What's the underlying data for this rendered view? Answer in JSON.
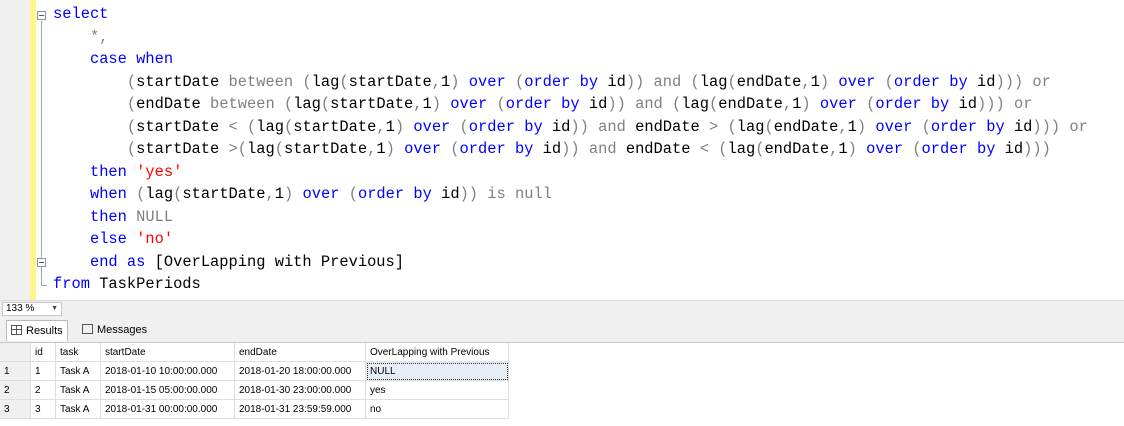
{
  "editor": {
    "lines": [
      [
        {
          "t": "select",
          "c": "kw"
        }
      ],
      [
        {
          "t": "    *,",
          "c": "gr"
        }
      ],
      [
        {
          "t": "    "
        },
        {
          "t": "case when",
          "c": "kw"
        }
      ],
      [
        {
          "t": "        "
        },
        {
          "t": "(",
          "c": "gr"
        },
        {
          "t": "startDate "
        },
        {
          "t": "between",
          "c": "gr"
        },
        {
          "t": " "
        },
        {
          "t": "(",
          "c": "gr"
        },
        {
          "t": "lag"
        },
        {
          "t": "(",
          "c": "gr"
        },
        {
          "t": "startDate"
        },
        {
          "t": ",",
          "c": "gr"
        },
        {
          "t": "1"
        },
        {
          "t": ")",
          "c": "gr"
        },
        {
          "t": " "
        },
        {
          "t": "over",
          "c": "kw"
        },
        {
          "t": " "
        },
        {
          "t": "(",
          "c": "gr"
        },
        {
          "t": "order by",
          "c": "kw"
        },
        {
          "t": " id"
        },
        {
          "t": "))",
          "c": "gr"
        },
        {
          "t": " "
        },
        {
          "t": "and",
          "c": "gr"
        },
        {
          "t": " "
        },
        {
          "t": "(",
          "c": "gr"
        },
        {
          "t": "lag"
        },
        {
          "t": "(",
          "c": "gr"
        },
        {
          "t": "endDate"
        },
        {
          "t": ",",
          "c": "gr"
        },
        {
          "t": "1"
        },
        {
          "t": ")",
          "c": "gr"
        },
        {
          "t": " "
        },
        {
          "t": "over",
          "c": "kw"
        },
        {
          "t": " "
        },
        {
          "t": "(",
          "c": "gr"
        },
        {
          "t": "order by",
          "c": "kw"
        },
        {
          "t": " id"
        },
        {
          "t": ")))",
          "c": "gr"
        },
        {
          "t": " "
        },
        {
          "t": "or",
          "c": "gr"
        }
      ],
      [
        {
          "t": "        "
        },
        {
          "t": "(",
          "c": "gr"
        },
        {
          "t": "endDate "
        },
        {
          "t": "between",
          "c": "gr"
        },
        {
          "t": " "
        },
        {
          "t": "(",
          "c": "gr"
        },
        {
          "t": "lag"
        },
        {
          "t": "(",
          "c": "gr"
        },
        {
          "t": "startDate"
        },
        {
          "t": ",",
          "c": "gr"
        },
        {
          "t": "1"
        },
        {
          "t": ")",
          "c": "gr"
        },
        {
          "t": " "
        },
        {
          "t": "over",
          "c": "kw"
        },
        {
          "t": " "
        },
        {
          "t": "(",
          "c": "gr"
        },
        {
          "t": "order by",
          "c": "kw"
        },
        {
          "t": " id"
        },
        {
          "t": "))",
          "c": "gr"
        },
        {
          "t": " "
        },
        {
          "t": "and",
          "c": "gr"
        },
        {
          "t": " "
        },
        {
          "t": "(",
          "c": "gr"
        },
        {
          "t": "lag"
        },
        {
          "t": "(",
          "c": "gr"
        },
        {
          "t": "endDate"
        },
        {
          "t": ",",
          "c": "gr"
        },
        {
          "t": "1"
        },
        {
          "t": ")",
          "c": "gr"
        },
        {
          "t": " "
        },
        {
          "t": "over",
          "c": "kw"
        },
        {
          "t": " "
        },
        {
          "t": "(",
          "c": "gr"
        },
        {
          "t": "order by",
          "c": "kw"
        },
        {
          "t": " id"
        },
        {
          "t": ")))",
          "c": "gr"
        },
        {
          "t": " "
        },
        {
          "t": "or",
          "c": "gr"
        }
      ],
      [
        {
          "t": "        "
        },
        {
          "t": "(",
          "c": "gr"
        },
        {
          "t": "startDate "
        },
        {
          "t": "<",
          "c": "gr"
        },
        {
          "t": " "
        },
        {
          "t": "(",
          "c": "gr"
        },
        {
          "t": "lag"
        },
        {
          "t": "(",
          "c": "gr"
        },
        {
          "t": "startDate"
        },
        {
          "t": ",",
          "c": "gr"
        },
        {
          "t": "1"
        },
        {
          "t": ")",
          "c": "gr"
        },
        {
          "t": " "
        },
        {
          "t": "over",
          "c": "kw"
        },
        {
          "t": " "
        },
        {
          "t": "(",
          "c": "gr"
        },
        {
          "t": "order by",
          "c": "kw"
        },
        {
          "t": " id"
        },
        {
          "t": "))",
          "c": "gr"
        },
        {
          "t": " "
        },
        {
          "t": "and",
          "c": "gr"
        },
        {
          "t": " endDate "
        },
        {
          "t": ">",
          "c": "gr"
        },
        {
          "t": " "
        },
        {
          "t": "(",
          "c": "gr"
        },
        {
          "t": "lag"
        },
        {
          "t": "(",
          "c": "gr"
        },
        {
          "t": "endDate"
        },
        {
          "t": ",",
          "c": "gr"
        },
        {
          "t": "1"
        },
        {
          "t": ")",
          "c": "gr"
        },
        {
          "t": " "
        },
        {
          "t": "over",
          "c": "kw"
        },
        {
          "t": " "
        },
        {
          "t": "(",
          "c": "gr"
        },
        {
          "t": "order by",
          "c": "kw"
        },
        {
          "t": " id"
        },
        {
          "t": ")))",
          "c": "gr"
        },
        {
          "t": " "
        },
        {
          "t": "or",
          "c": "gr"
        }
      ],
      [
        {
          "t": "        "
        },
        {
          "t": "(",
          "c": "gr"
        },
        {
          "t": "startDate "
        },
        {
          "t": ">(",
          "c": "gr"
        },
        {
          "t": "lag"
        },
        {
          "t": "(",
          "c": "gr"
        },
        {
          "t": "startDate"
        },
        {
          "t": ",",
          "c": "gr"
        },
        {
          "t": "1"
        },
        {
          "t": ")",
          "c": "gr"
        },
        {
          "t": " "
        },
        {
          "t": "over",
          "c": "kw"
        },
        {
          "t": " "
        },
        {
          "t": "(",
          "c": "gr"
        },
        {
          "t": "order by",
          "c": "kw"
        },
        {
          "t": " id"
        },
        {
          "t": "))",
          "c": "gr"
        },
        {
          "t": " "
        },
        {
          "t": "and",
          "c": "gr"
        },
        {
          "t": " endDate "
        },
        {
          "t": "<",
          "c": "gr"
        },
        {
          "t": " "
        },
        {
          "t": "(",
          "c": "gr"
        },
        {
          "t": "lag"
        },
        {
          "t": "(",
          "c": "gr"
        },
        {
          "t": "endDate"
        },
        {
          "t": ",",
          "c": "gr"
        },
        {
          "t": "1"
        },
        {
          "t": ")",
          "c": "gr"
        },
        {
          "t": " "
        },
        {
          "t": "over",
          "c": "kw"
        },
        {
          "t": " "
        },
        {
          "t": "(",
          "c": "gr"
        },
        {
          "t": "order by",
          "c": "kw"
        },
        {
          "t": " id"
        },
        {
          "t": ")))",
          "c": "gr"
        }
      ],
      [
        {
          "t": "    "
        },
        {
          "t": "then",
          "c": "kw"
        },
        {
          "t": " "
        },
        {
          "t": "'yes'",
          "c": "st"
        }
      ],
      [
        {
          "t": "    "
        },
        {
          "t": "when",
          "c": "kw"
        },
        {
          "t": " "
        },
        {
          "t": "(",
          "c": "gr"
        },
        {
          "t": "lag"
        },
        {
          "t": "(",
          "c": "gr"
        },
        {
          "t": "startDate"
        },
        {
          "t": ",",
          "c": "gr"
        },
        {
          "t": "1"
        },
        {
          "t": ")",
          "c": "gr"
        },
        {
          "t": " "
        },
        {
          "t": "over",
          "c": "kw"
        },
        {
          "t": " "
        },
        {
          "t": "(",
          "c": "gr"
        },
        {
          "t": "order by",
          "c": "kw"
        },
        {
          "t": " id"
        },
        {
          "t": "))",
          "c": "gr"
        },
        {
          "t": " "
        },
        {
          "t": "is null",
          "c": "gr"
        }
      ],
      [
        {
          "t": "    "
        },
        {
          "t": "then",
          "c": "kw"
        },
        {
          "t": " "
        },
        {
          "t": "NULL",
          "c": "gr"
        }
      ],
      [
        {
          "t": "    "
        },
        {
          "t": "else",
          "c": "kw"
        },
        {
          "t": " "
        },
        {
          "t": "'no'",
          "c": "st"
        }
      ],
      [
        {
          "t": "    "
        },
        {
          "t": "end",
          "c": "kw"
        },
        {
          "t": " "
        },
        {
          "t": "as",
          "c": "kw"
        },
        {
          "t": " [OverLapping with Previous]"
        }
      ],
      [
        {
          "t": "from",
          "c": "kw"
        },
        {
          "t": " TaskPeriods"
        }
      ]
    ]
  },
  "zoom": {
    "value": "133 %"
  },
  "tabs": {
    "results": "Results",
    "messages": "Messages"
  },
  "results": {
    "columns": [
      "",
      "id",
      "task",
      "startDate",
      "endDate",
      "OverLapping with Previous"
    ],
    "rows": [
      [
        "1",
        "1",
        "Task A",
        "2018-01-10 10:00:00.000",
        "2018-01-20 18:00:00.000",
        "NULL"
      ],
      [
        "2",
        "2",
        "Task A",
        "2018-01-15 05:00:00.000",
        "2018-01-30 23:00:00.000",
        "yes"
      ],
      [
        "3",
        "3",
        "Task A",
        "2018-01-31 00:00:00.000",
        "2018-01-31 23:59:59.000",
        "no"
      ]
    ]
  }
}
